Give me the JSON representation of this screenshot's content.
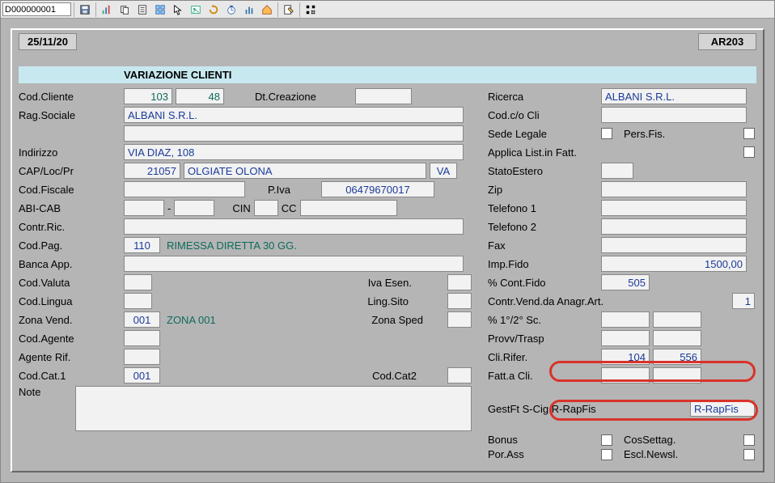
{
  "toolbar": {
    "docnum": "D000000001"
  },
  "top": {
    "date": "25/11/20",
    "screen": "AR203"
  },
  "panel_title": "VARIAZIONE CLIENTI",
  "labels": {
    "cod_cliente": "Cod.Cliente",
    "dt_creazione": "Dt.Creazione",
    "ricerca": "Ricerca",
    "rag_sociale": "Rag.Sociale",
    "cod_co_cli": "Cod.c/o Cli",
    "sede_legale": "Sede Legale",
    "pers_fis": "Pers.Fis.",
    "indirizzo": "Indirizzo",
    "applica_list": "Applica List.in Fatt.",
    "cap_loc_pr": "CAP/Loc/Pr",
    "stato_estero": "StatoEstero",
    "cod_fiscale": "Cod.Fiscale",
    "p_iva": "P.Iva",
    "zip": "Zip",
    "abi_cab": "ABI-CAB",
    "cin": "CIN",
    "cc": "CC",
    "telefono1": "Telefono 1",
    "contr_ric": "Contr.Ric.",
    "telefono2": "Telefono 2",
    "cod_pag": "Cod.Pag.",
    "fax": "Fax",
    "banca_app": "Banca App.",
    "imp_fido": "Imp.Fido",
    "cod_valuta": "Cod.Valuta",
    "iva_esen": "Iva Esen.",
    "pct_cont_fido": "% Cont.Fido",
    "cod_lingua": "Cod.Lingua",
    "ling_sito": "Ling.Sito",
    "contr_vend_anagr": "Contr.Vend.da Anagr.Art.",
    "zona_vend": "Zona Vend.",
    "zona_sped": "Zona Sped",
    "pct_1_2_sc": "% 1°/2° Sc.",
    "cod_agente": "Cod.Agente",
    "provv_trasp": "Provv/Trasp",
    "agente_rif": "Agente Rif.",
    "cli_rifer": "Cli.Rifer.",
    "cod_cat1": "Cod.Cat.1",
    "cod_cat2": "Cod.Cat2",
    "fatt_a_cli": "Fatt.a Cli.",
    "note": "Note",
    "gestft": "GestFt S-Cig R-RapFis",
    "bonus": "Bonus",
    "cossettag": "CosSettag.",
    "por_ass": "Por.Ass",
    "escl_newsl": "Escl.Newsl."
  },
  "values": {
    "cod_cliente_1": "103",
    "cod_cliente_2": "48",
    "ricerca": "ALBANI  S.R.L.",
    "rag_sociale": "ALBANI  S.R.L.",
    "indirizzo": "VIA DIAZ, 108",
    "cap": "21057",
    "loc": "OLGIATE OLONA",
    "pr": "VA",
    "p_iva": "06479670017",
    "abi_dash": "-",
    "cod_pag": "110",
    "cod_pag_desc": "RIMESSA DIRETTA 30 GG.",
    "imp_fido": "1500,00",
    "pct_cont_fido": "505",
    "contr_vend_anagr": "1",
    "zona_vend": "001",
    "zona_vend_desc": "ZONA 001",
    "cli_rifer_1": "104",
    "cli_rifer_2": "556",
    "cod_cat1": "001",
    "gestft_val": "R-RapFis"
  },
  "icons": {
    "save": "save",
    "chart": "chart",
    "copy": "copy",
    "paste": "paste",
    "group": "group",
    "arrow": "arrow",
    "green": "green",
    "clock": "clock",
    "web": "web",
    "bars": "bars",
    "home": "home",
    "edit": "edit",
    "qr": "qr"
  }
}
